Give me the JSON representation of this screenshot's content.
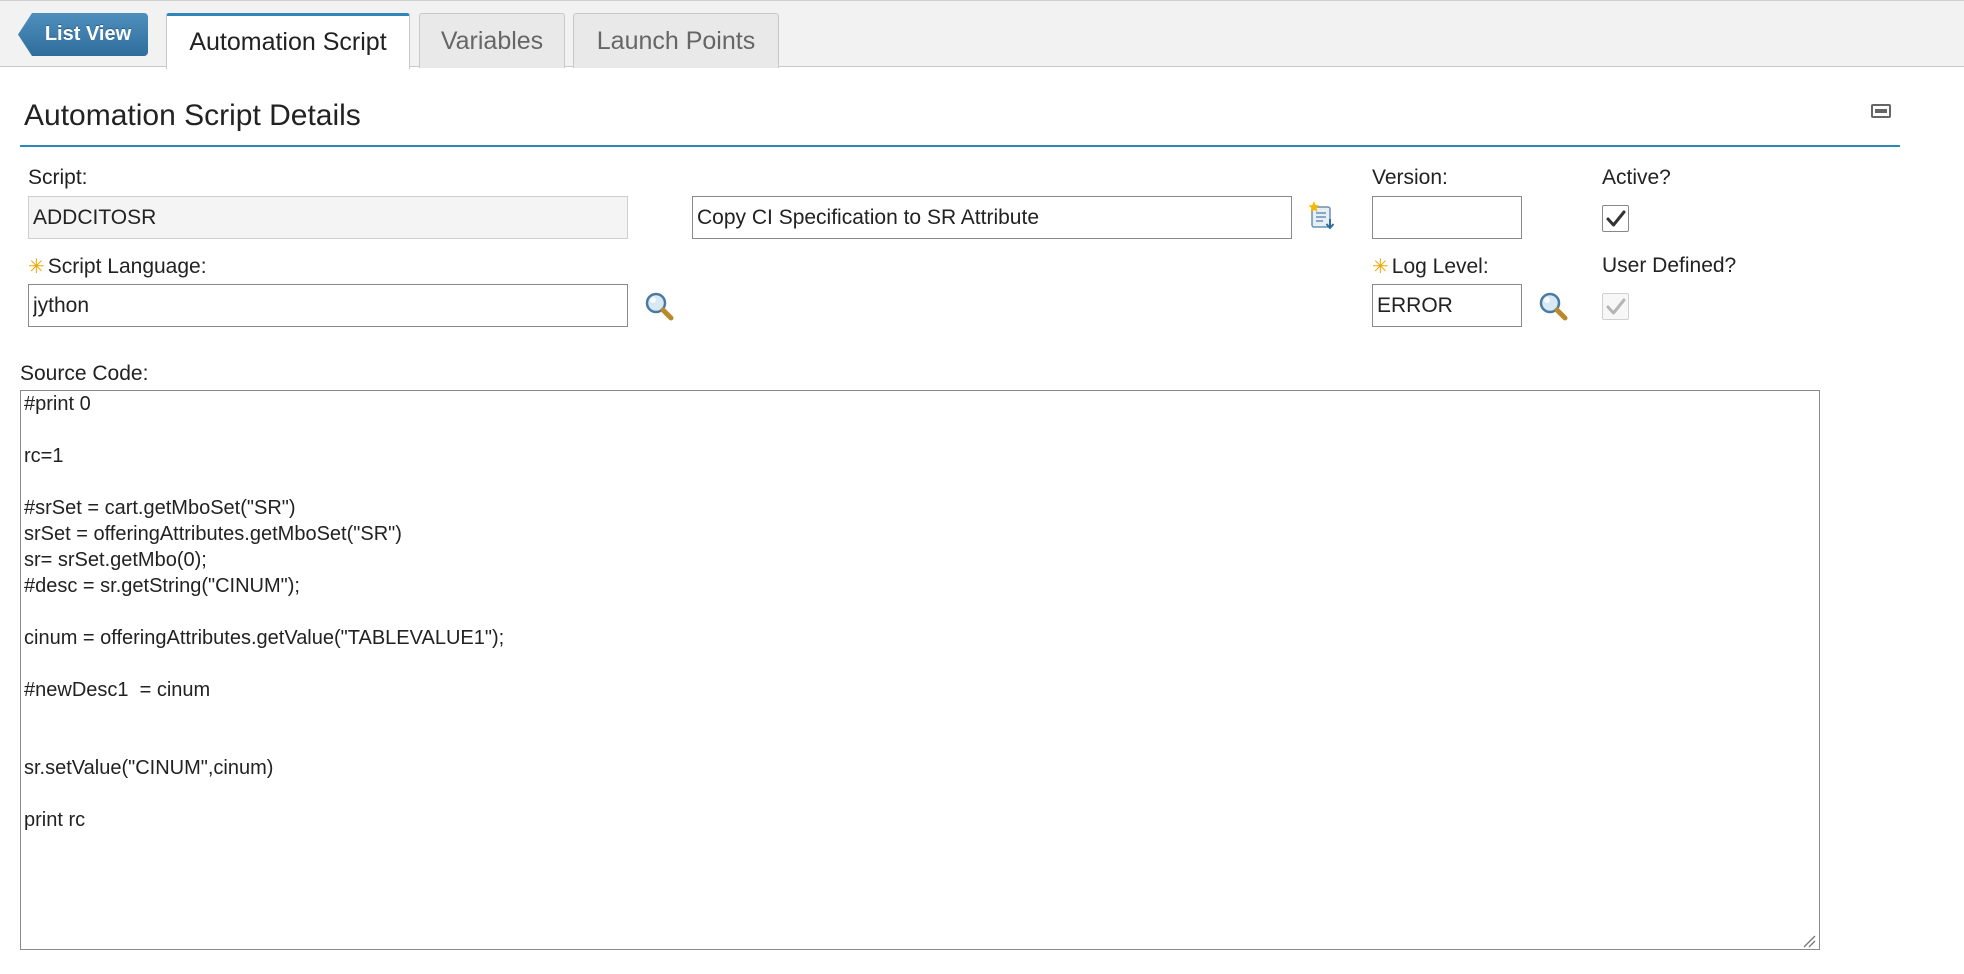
{
  "nav": {
    "list_view_label": "List View",
    "tabs": [
      {
        "label": "Automation Script",
        "active": true
      },
      {
        "label": "Variables",
        "active": false
      },
      {
        "label": "Launch Points",
        "active": false
      }
    ]
  },
  "section": {
    "title": "Automation Script Details"
  },
  "form": {
    "script_label": "Script:",
    "script_value": "ADDCITOSR",
    "description_value": "Copy CI Specification to SR Attribute",
    "version_label": "Version:",
    "version_value": "",
    "active_label": "Active?",
    "active_checked": true,
    "script_language_label": "Script Language:",
    "script_language_value": "jython",
    "log_level_label": "Log Level:",
    "log_level_value": "ERROR",
    "user_defined_label": "User Defined?",
    "user_defined_checked": true,
    "required_marker": "✳"
  },
  "source": {
    "label": "Source Code:",
    "code": "#print 0\n\nrc=1\n\n#srSet = cart.getMboSet(\"SR\")\nsrSet = offeringAttributes.getMboSet(\"SR\")\nsr= srSet.getMbo(0);\n#desc = sr.getString(\"CINUM\");\n\ncinum = offeringAttributes.getValue(\"TABLEVALUE1\");\n\n#newDesc1  = cinum\n\n\nsr.setValue(\"CINUM\",cinum)\n\nprint rc"
  },
  "icons": {
    "lookup": "magnifier-icon",
    "detail_menu": "detail-menu-icon",
    "collapse": "collapse-section-icon",
    "checkmark": "checkmark-icon"
  },
  "colors": {
    "accent": "#2f86b8",
    "list_view_button": "#3b7aa8",
    "required": "#f0a500"
  }
}
